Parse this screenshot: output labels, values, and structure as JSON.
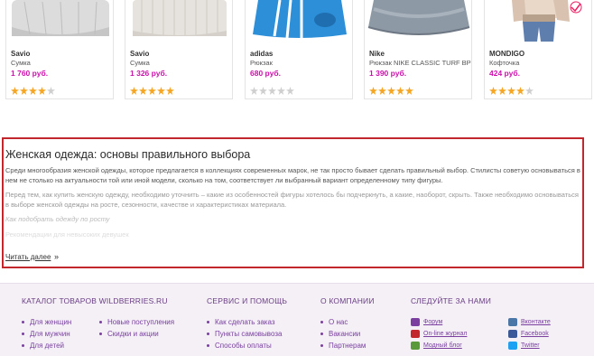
{
  "products": [
    {
      "brand": "Savio",
      "desc": "Сумка",
      "price": "1 760 руб.",
      "rating": 4
    },
    {
      "brand": "Savio",
      "desc": "Сумка",
      "price": "1 326 руб.",
      "rating": 5
    },
    {
      "brand": "adidas",
      "desc": "Рюкзак",
      "price": "680 руб.",
      "rating": 0
    },
    {
      "brand": "Nike",
      "desc": "Рюкзак NIKE CLASSIC TURF BP",
      "price": "1 390 руб.",
      "rating": 5
    },
    {
      "brand": "MONDIGO",
      "desc": "Кофточка",
      "price": "424 руб.",
      "rating": 4
    }
  ],
  "article": {
    "title": "Женская одежда: основы правильного выбора",
    "p1": "Среди многообразия женской одежды, которое предлагается в коллекциях современных марок, не так просто бывает сделать правильный выбор. Стилисты советую основываться в нем не столько на актуальности той или иной модели, сколько на том, соответствует ли выбранный вариант определенному типу фигуры.",
    "p2": "Перед тем, как купить женскую одежду, необходимо уточнить – какие из особенностей фигуры хотелось бы подчеркнуть, а какие, наоборот, скрыть. Также необходимо основываться в выборе женской одежды на росте, сезонности, качестве и характеристиках материала.",
    "p3": "Как подобрать одежду по росту",
    "p4": "Рекомендации для невысоких девушек",
    "more": "Читать далее",
    "more_arrow": "»",
    "frame_color": "#c1272d"
  },
  "footer": {
    "catalog": {
      "title": "КАТАЛОГ ТОВАРОВ WILDBERRIES.RU",
      "col1": [
        "Для женщин",
        "Для мужчин",
        "Для детей"
      ],
      "col2": [
        "Новые поступления",
        "Скидки и акции"
      ]
    },
    "service": {
      "title": "СЕРВИС И ПОМОЩЬ",
      "items": [
        "Как сделать заказ",
        "Пункты самовывоза",
        "Способы оплаты"
      ]
    },
    "company": {
      "title": "О КОМПАНИИ",
      "items": [
        "О нас",
        "Вакансии",
        "Партнерам"
      ]
    },
    "social": {
      "title": "СЛЕДУЙТЕ ЗА НАМИ",
      "left": [
        {
          "label": "Форум",
          "icon": "forum-icon",
          "color": "#7a3f9f"
        },
        {
          "label": "On-line журнал",
          "icon": "journal-icon",
          "color": "#c1272d"
        },
        {
          "label": "Модный блог",
          "icon": "blog-icon",
          "color": "#5a9a3a"
        }
      ],
      "right": [
        {
          "label": "Вконтакте",
          "icon": "vk-icon",
          "color": "#4a76a8"
        },
        {
          "label": "Facebook",
          "icon": "facebook-icon",
          "color": "#3b5998"
        },
        {
          "label": "Twitter",
          "icon": "twitter-icon",
          "color": "#1da1f2"
        }
      ]
    }
  },
  "colors": {
    "price": "#cb11ab",
    "link": "#7a3f9f",
    "star": "#f5a623"
  }
}
